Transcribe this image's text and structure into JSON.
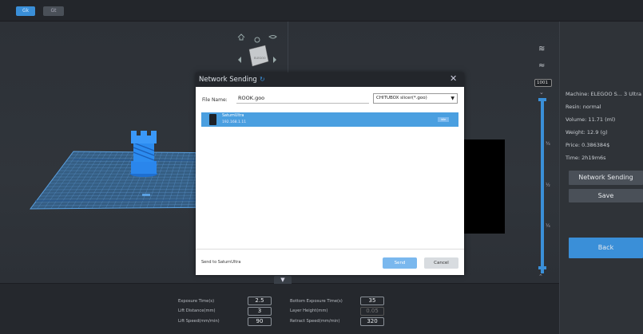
{
  "toolbar": {
    "btn1": "Gk",
    "btn2": "Gt"
  },
  "scene": {
    "cube_label": "ELEGOO",
    "cube_sublabel": "Front"
  },
  "dialog": {
    "title": "Network Sending",
    "file_name_label": "File Name:",
    "file_name_value": "ROOK.goo",
    "format": "CHITUBOX slicer(*.goo)",
    "printer_name": "SaturnUltra",
    "printer_ip": "192.168.1.11",
    "printer_status": "Idle",
    "send_to": "Send to SaturnUltra",
    "send_label": "Send",
    "cancel_label": "Cancel"
  },
  "info": {
    "machine": "Machine:  ELEGOO S... 3 Ultra",
    "resin": "Resin:  normal",
    "volume": "Volume:  11.71  (ml)",
    "weight": "Weight:  12.9  (g)",
    "price": "Price:  0.386384$",
    "time": "Time:  2h19m6s"
  },
  "buttons": {
    "network": "Network Sending",
    "save": "Save",
    "back": "Back"
  },
  "layer": {
    "value": "1001",
    "mark1": "¾",
    "mark2": "½",
    "mark3": "¼"
  },
  "params": {
    "exposure_label": "Exposure Time(s)",
    "exposure": "2.5",
    "lift_dist_label": "Lift Distance(mm)",
    "lift_dist": "3",
    "lift_speed_label": "Lift Speed(mm/min)",
    "lift_speed": "90",
    "bottom_exposure_label": "Bottom Exposure Time(s)",
    "bottom_exposure": "35",
    "layer_height_label": "Layer Height(mm)",
    "layer_height": "0.05",
    "retract_label": "Retract Speed(mm/min)",
    "retract": "320"
  },
  "colors": {
    "accent": "#3a8fd8",
    "highlight": "#4a9fe0"
  }
}
